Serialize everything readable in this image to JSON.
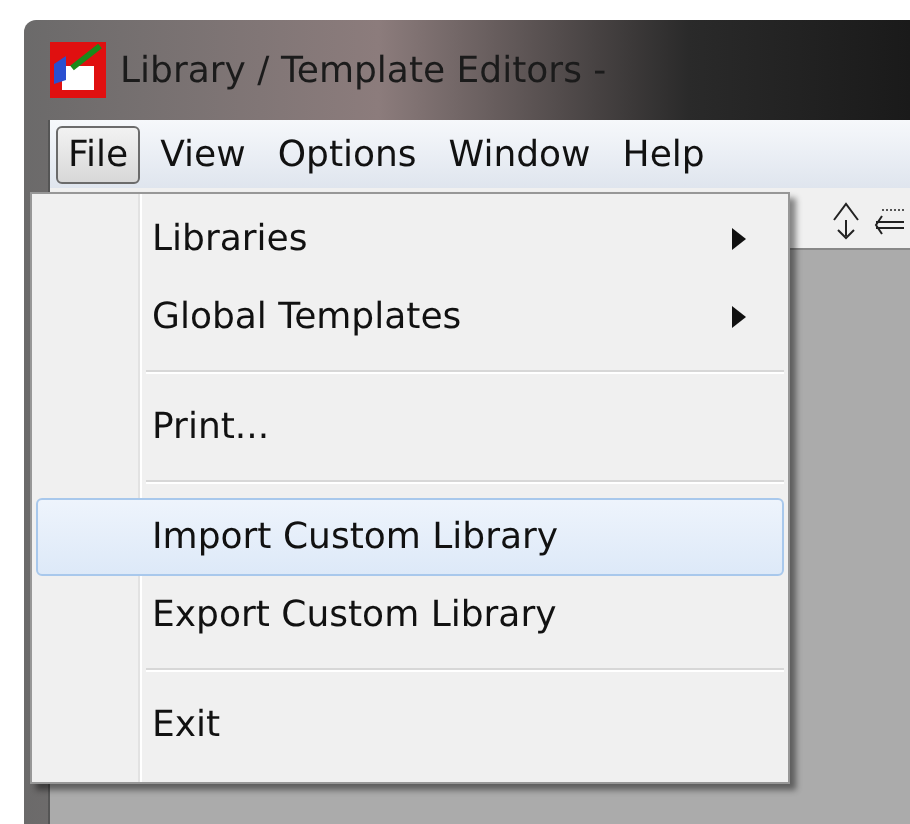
{
  "window": {
    "title": "Library / Template Editors -"
  },
  "menu_bar": [
    {
      "label": "File",
      "selected": true
    },
    {
      "label": "View",
      "selected": false
    },
    {
      "label": "Options",
      "selected": false
    },
    {
      "label": "Window",
      "selected": false
    },
    {
      "label": "Help",
      "selected": false
    }
  ],
  "file_menu": [
    {
      "kind": "submenu",
      "label": "Libraries",
      "selected": false
    },
    {
      "kind": "submenu",
      "label": "Global Templates",
      "selected": false
    },
    {
      "kind": "separator"
    },
    {
      "kind": "command",
      "label": "Print...",
      "selected": false
    },
    {
      "kind": "separator"
    },
    {
      "kind": "command",
      "label": "Import Custom Library",
      "selected": true
    },
    {
      "kind": "command",
      "label": "Export Custom Library",
      "selected": false
    },
    {
      "kind": "separator"
    },
    {
      "kind": "command",
      "label": "Exit",
      "selected": false
    }
  ]
}
